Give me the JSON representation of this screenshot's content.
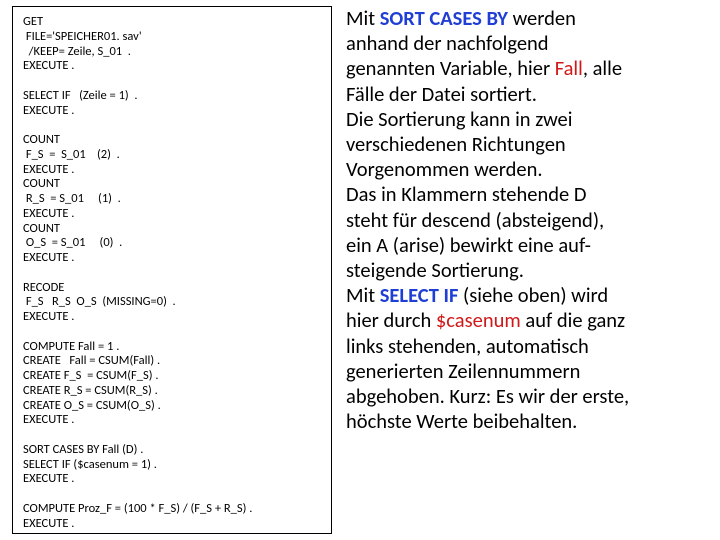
{
  "code": {
    "block1": "GET\n FILE='SPEICHER01. sav'\n  /KEEP= Zeile, S_01  .\nEXECUTE .",
    "block2": "SELECT IF   (Zeile = 1)  .\nEXECUTE .",
    "block3": "COUNT\n F_S  =  S_01    (2)  .\nEXECUTE .\nCOUNT\n R_S  = S_01     (1)  .\nEXECUTE .\nCOUNT\n O_S  = S_01     (0)  .\nEXECUTE .",
    "block4": "RECODE\n F_S   R_S  O_S  (MISSING=0)  .\nEXECUTE .",
    "block5": "COMPUTE Fall = 1 .\nCREATE   Fall = CSUM(Fall) .\nCREATE F_S  = CSUM(F_S) .\nCREATE R_S = CSUM(R_S) .\nCREATE O_S = CSUM(O_S) .\nEXECUTE .",
    "block6": "SORT CASES BY Fall (D) .\nSELECT IF ($casenum = 1) .\nEXECUTE .",
    "block7": "COMPUTE Proz_F = (100 * F_S) / (F_S + R_S) .\nEXECUTE ."
  },
  "text": {
    "t1a": "Mit ",
    "kw_sort": "SORT CASES BY",
    "t1b": " werden",
    "t2": "anhand der nachfolgend",
    "t3a": "genannten Variable, hier ",
    "kw_fall": "Fall",
    "t3b": ", alle",
    "t4": "Fälle der Datei sortiert.",
    "t5": "Die Sortierung kann in zwei",
    "t6": "verschiedenen Richtungen",
    "t7": "Vorgenommen werden.",
    "t8": "Das in Klammern stehende D",
    "t9": "steht für descend (absteigend),",
    "t10": "ein A (arise) bewirkt eine auf-",
    "t11": "steigende Sortierung.",
    "t12a": "Mit ",
    "kw_select": "SELECT IF",
    "t12b": " (siehe oben) wird",
    "t13a": "hier durch ",
    "kw_case": "$casenum",
    "t13b": " auf die ganz",
    "t14": "links stehenden, automatisch",
    "t15": "generierten Zeilennummern",
    "t16": "abgehoben. Kurz: Es wir der erste,",
    "t17": "höchste Werte beibehalten."
  }
}
